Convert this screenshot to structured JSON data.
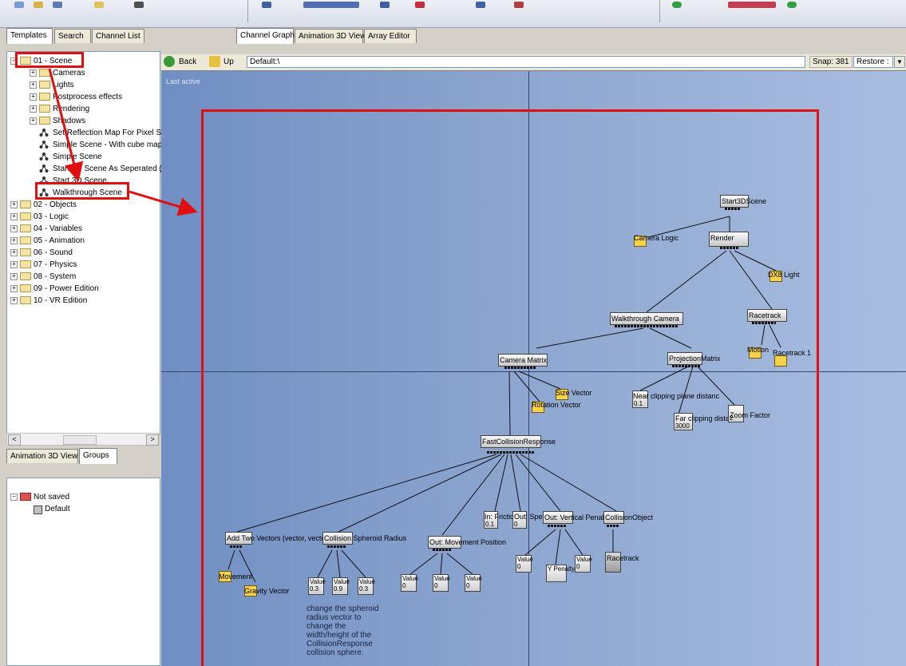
{
  "left_tabs": [
    "Templates",
    "Search",
    "Channel List"
  ],
  "graph_tabs": [
    "Channel Graph",
    "Animation 3D View",
    "Array Editor"
  ],
  "tree": {
    "scene_folder": "01 - Scene",
    "scene_children": [
      "Cameras",
      "Lights",
      "Postprocess effects",
      "Rendering",
      "Shadows",
      "Set Reflection Map For Pixel SI",
      "Simple Scene - With cube map",
      "Simple Scene",
      "Start 3D Scene As Seperated (",
      "Start 3D Scene",
      "Walkthrough Scene"
    ],
    "other_folders": [
      "02 - Objects",
      "03 - Logic",
      "04 - Variables",
      "05 - Animation",
      "06 - Sound",
      "07 - Physics",
      "08 - System",
      "09 - Power Edition",
      "10 - VR Edition"
    ]
  },
  "bottom_tabs": [
    "Animation 3D View",
    "Groups"
  ],
  "groups": {
    "root": "Not saved",
    "child": "Default"
  },
  "graph_header": {
    "back": "Back",
    "up": "Up",
    "path": "Default:\\",
    "snap": "Snap: 381",
    "restore": "Restore :"
  },
  "graph": {
    "last_active": "Last active",
    "nodes": {
      "start3dscene": "Start3DScene",
      "camera_logic": "Camera Logic",
      "render": "Render",
      "dx8_light": "DX8 Light",
      "walkthrough_camera": "Walkthrough Camera",
      "racetrack": "Racetrack",
      "motion": "Motion",
      "racetrack1": "Racetrack 1",
      "camera_matrix": "Camera Matrix",
      "projection_matrix": "ProjectionMatrix",
      "size_vector": "Size Vector",
      "rotation_vector": "Rotation Vector",
      "near_clip": "Near clipping plane distanc",
      "near_val": "0.1",
      "far_clip": "Far clipping distance",
      "far_val": "3000",
      "zoom_factor": "Zoom Factor",
      "zoom_val": "2",
      "fast_collision": "FastCollisionResponse",
      "add_two_vectors": "Add Two Vectors (vector, vector)",
      "collision_spheroid": "Collision Spheroid Radius",
      "out_movement": "Out: Movement Position",
      "in_friction": "In: Friction",
      "in_friction_val": "0.1",
      "out_speed": "Out: Speed",
      "out_speed_val": "0",
      "out_vertical": "Out: Vertical Penalty",
      "collision_object": "CollisionObject",
      "movement": "Movement",
      "gravity_vector": "Gravity Vector",
      "value_label": "Value",
      "val_03": "0.3",
      "val_09": "0.9",
      "val_0": "0",
      "y_penalty": "Y Penalty",
      "racetrack_obj": "Racetrack",
      "comment": "change the spheroid radius vector to change the width/height of the CollisionResponse collision sphere."
    }
  },
  "colors": {
    "highlight": "#e01010",
    "graph_bg": "#8ea7d0"
  }
}
